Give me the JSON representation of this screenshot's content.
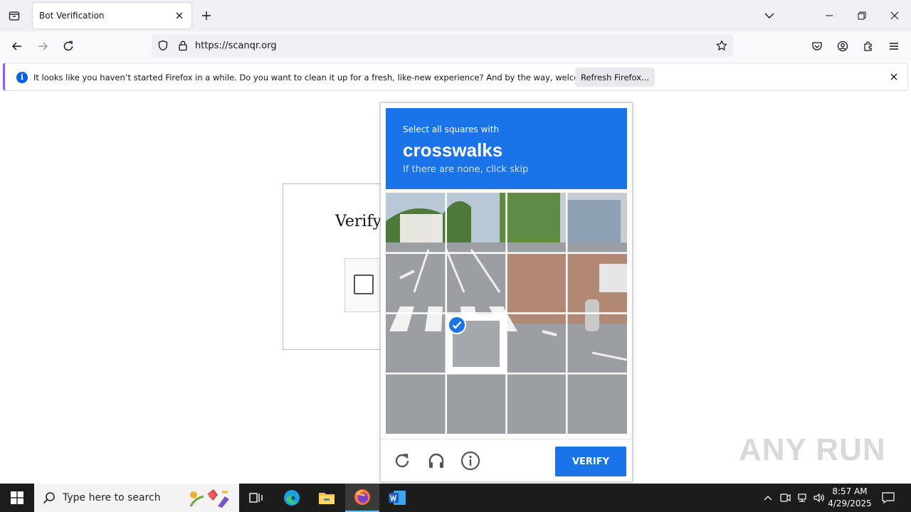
{
  "browser": {
    "tab_title": "Bot Verification",
    "url": "https://scanqr.org"
  },
  "notification": {
    "message": "It looks like you haven’t started Firefox in a while. Do you want to clean it up for a fresh, like-new experience? And by the way, welcome back!",
    "button_label": "Refresh Firefox..."
  },
  "page": {
    "verify_title": "Verifyi"
  },
  "captcha": {
    "instruction": "Select all squares with",
    "target": "crosswalks",
    "hint": "If there are none, click skip",
    "selected_tiles": [
      9
    ],
    "verify_label": "VERIFY",
    "colors": {
      "accent": "#1a73e8"
    }
  },
  "watermark": "ANY RUN",
  "taskbar": {
    "search_placeholder": "Type here to search",
    "time": "8:57 AM",
    "date": "4/29/2025"
  }
}
